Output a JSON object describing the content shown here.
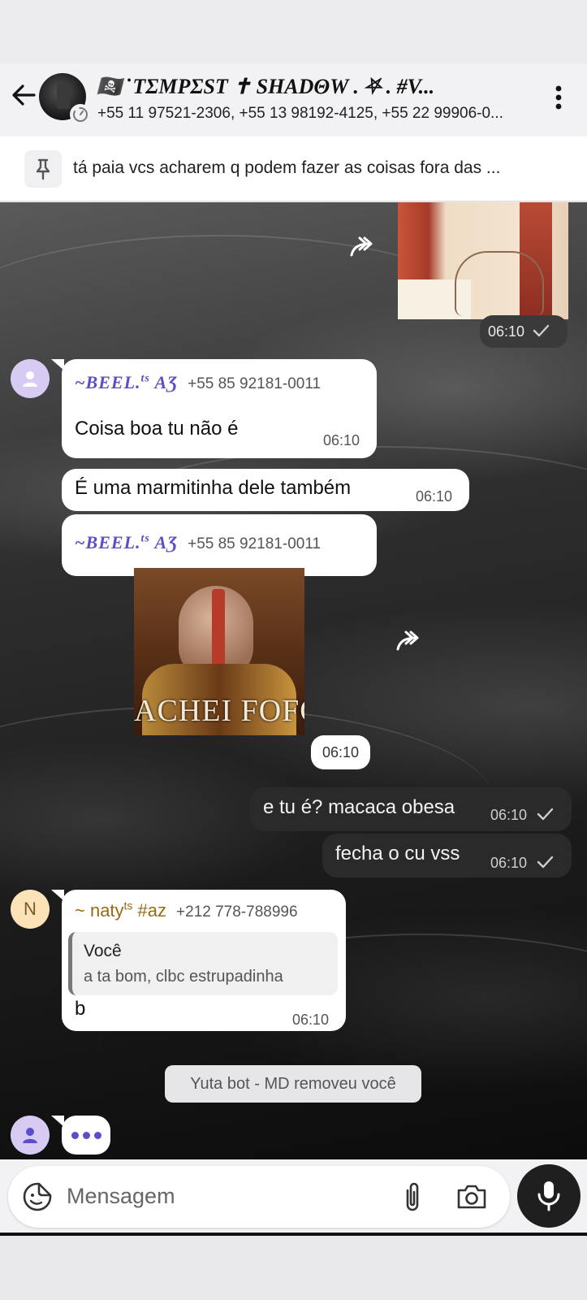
{
  "header": {
    "title": "🏴‍☠️  ̇  ΤΣΜΡΣЅΤ ✝ ЅΗΑDΘW . ⛧ .  #V...",
    "members": "+55 11 97521-2306, +55 13 98192-4125, +55 22 99906-0..."
  },
  "pinned": {
    "text": "tá paia vcs acharem q podem fazer as coisas fora das ..."
  },
  "messages": {
    "m0": {
      "time": "06:10"
    },
    "m1": {
      "sender_prefix": "~",
      "sender_name": "BEEL.",
      "sender_sup": "ts",
      "sender_suffix": " AƷ",
      "sender_phone": "+55 85 92181-0011",
      "text": "Coisa boa tu não é",
      "time": "06:10"
    },
    "m2": {
      "text": "É uma marmitinha dele também",
      "time": "06:10"
    },
    "m3": {
      "sender_prefix": "~",
      "sender_name": "BEEL.",
      "sender_sup": "ts",
      "sender_suffix": " AƷ",
      "sender_phone": "+55 85 92181-0011"
    },
    "m4": {
      "image_caption": "ACHEI FOFO",
      "time": "06:10"
    },
    "m5": {
      "text": "e tu é? macaca obesa",
      "time": "06:10"
    },
    "m6": {
      "text": "fecha o cu vss",
      "time": "06:10"
    },
    "m7": {
      "avatar_letter": "N",
      "sender_name": "~ naty",
      "sender_sup": "ts",
      "sender_suffix": " #az",
      "sender_phone": "+212 778-788996",
      "quote_author": "Você",
      "quote_text": "a ta bom, clbc estrupadinha",
      "text": "b",
      "time": "06:10"
    }
  },
  "system": {
    "text": "Yuta bot - MD removeu você"
  },
  "composer": {
    "placeholder": "Mensagem"
  },
  "colors": {
    "accent": "#5a4fc8",
    "naty": "#9a6a14",
    "mic": "#1f1f1f"
  },
  "icons": [
    "back-arrow-icon",
    "timer-icon",
    "more-vert-icon",
    "pin-icon",
    "forward-icon",
    "check-icon",
    "person-icon",
    "emoji-icon",
    "attach-icon",
    "camera-icon",
    "mic-icon"
  ]
}
